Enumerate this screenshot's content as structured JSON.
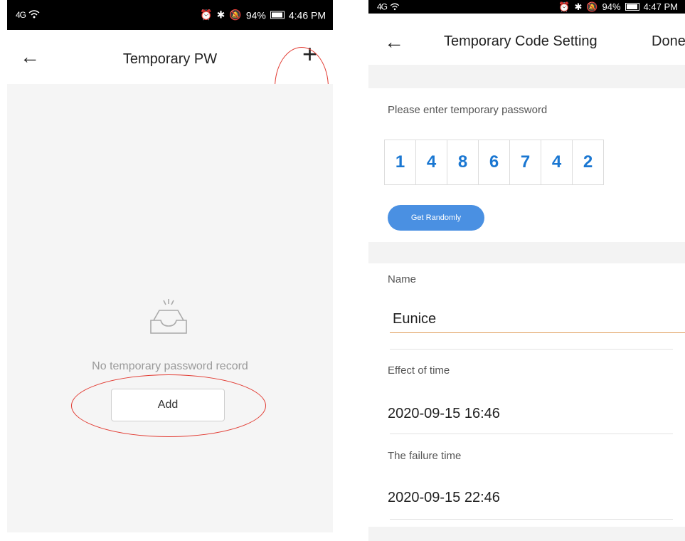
{
  "left": {
    "status": {
      "network": "4G",
      "battery": "94%",
      "time": "4:46 PM"
    },
    "title": "Temporary PW",
    "empty_text": "No temporary password record",
    "add_label": "Add"
  },
  "right": {
    "status": {
      "network": "4G",
      "battery": "94%",
      "time": "4:47 PM"
    },
    "title": "Temporary Code Setting",
    "done_label": "Done",
    "prompt": "Please enter temporary password",
    "digits": [
      "1",
      "4",
      "8",
      "6",
      "7",
      "4",
      "2"
    ],
    "random_label": "Get Randomly",
    "name_label": "Name",
    "name_value": "Eunice",
    "effect_label": "Effect of time",
    "effect_value": "2020-09-15 16:46",
    "failure_label": "The failure time",
    "failure_value": "2020-09-15 22:46"
  },
  "colors": {
    "accent": "#4a90e2",
    "digit": "#1a77d2",
    "annotation": "#e23b32",
    "input_line": "#e09a56"
  },
  "icons": [
    "back-arrow-icon",
    "plus-icon",
    "empty-tray-icon",
    "alarm-icon",
    "bluetooth-icon",
    "mute-icon",
    "battery-icon",
    "signal-icon",
    "wifi-icon"
  ]
}
